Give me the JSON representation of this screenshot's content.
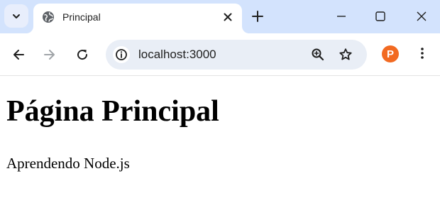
{
  "browser": {
    "tab": {
      "title": "Principal",
      "favicon": "globe-icon"
    },
    "address_bar": {
      "url": "localhost:3000"
    },
    "icons": {
      "tab_search": "chevron-down-icon",
      "close_tab": "close-icon",
      "new_tab": "plus-icon",
      "minimize": "minimize-icon",
      "maximize": "maximize-icon",
      "close_window": "close-icon",
      "back": "back-arrow-icon",
      "forward": "forward-arrow-icon",
      "reload": "reload-icon",
      "site_info": "info-icon",
      "zoom": "zoom-in-icon",
      "bookmark": "star-icon",
      "extension": "extension-avatar-icon",
      "menu": "more-vertical-icon"
    },
    "extension_letter": "P",
    "colors": {
      "tabstrip": "#d3e3fd",
      "omnibox": "#e9eef6",
      "extension": "#f26a21"
    }
  },
  "page": {
    "heading": "Página Principal",
    "paragraph": "Aprendendo Node.js"
  }
}
